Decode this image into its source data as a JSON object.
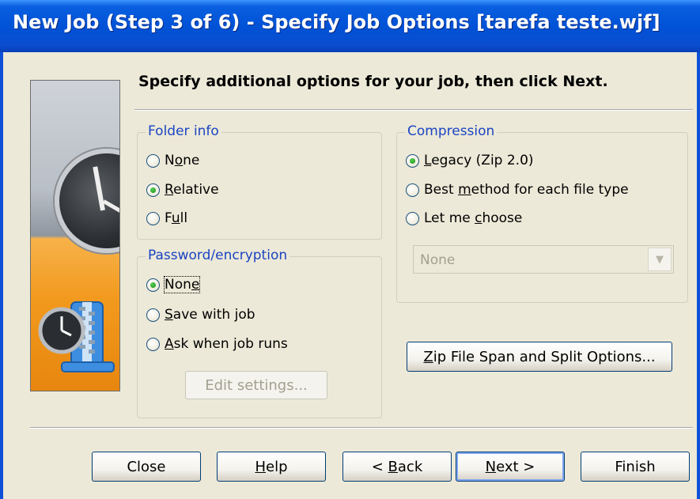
{
  "window": {
    "title": "New Job (Step 3 of 6) - Specify Job Options [tarefa teste.wjf]"
  },
  "instruction": "Specify additional options for your job, then click Next.",
  "folder_info": {
    "label": "Folder info",
    "options": [
      {
        "label": "None",
        "checked": false
      },
      {
        "label": "Relative",
        "checked": true
      },
      {
        "label": "Full",
        "checked": false
      }
    ]
  },
  "password": {
    "label": "Password/encryption",
    "options": [
      {
        "label": "None",
        "checked": true
      },
      {
        "label": "Save with job",
        "checked": false
      },
      {
        "label": "Ask when job runs",
        "checked": false
      }
    ],
    "edit_settings": "Edit settings..."
  },
  "compression": {
    "label": "Compression",
    "options": [
      {
        "label": "Legacy (Zip 2.0)",
        "checked": true
      },
      {
        "label": "Best method for each file type",
        "checked": false
      },
      {
        "label": "Let me choose",
        "checked": false
      }
    ],
    "method_value": "None"
  },
  "span_button": "Zip File Span and Split Options...",
  "buttons": {
    "close": "Close",
    "help": "Help",
    "back": "< Back",
    "next": "Next >",
    "finish": "Finish"
  },
  "icons": [
    "clock-banner-image",
    "zip-clock-icon",
    "chevron-down-icon"
  ]
}
